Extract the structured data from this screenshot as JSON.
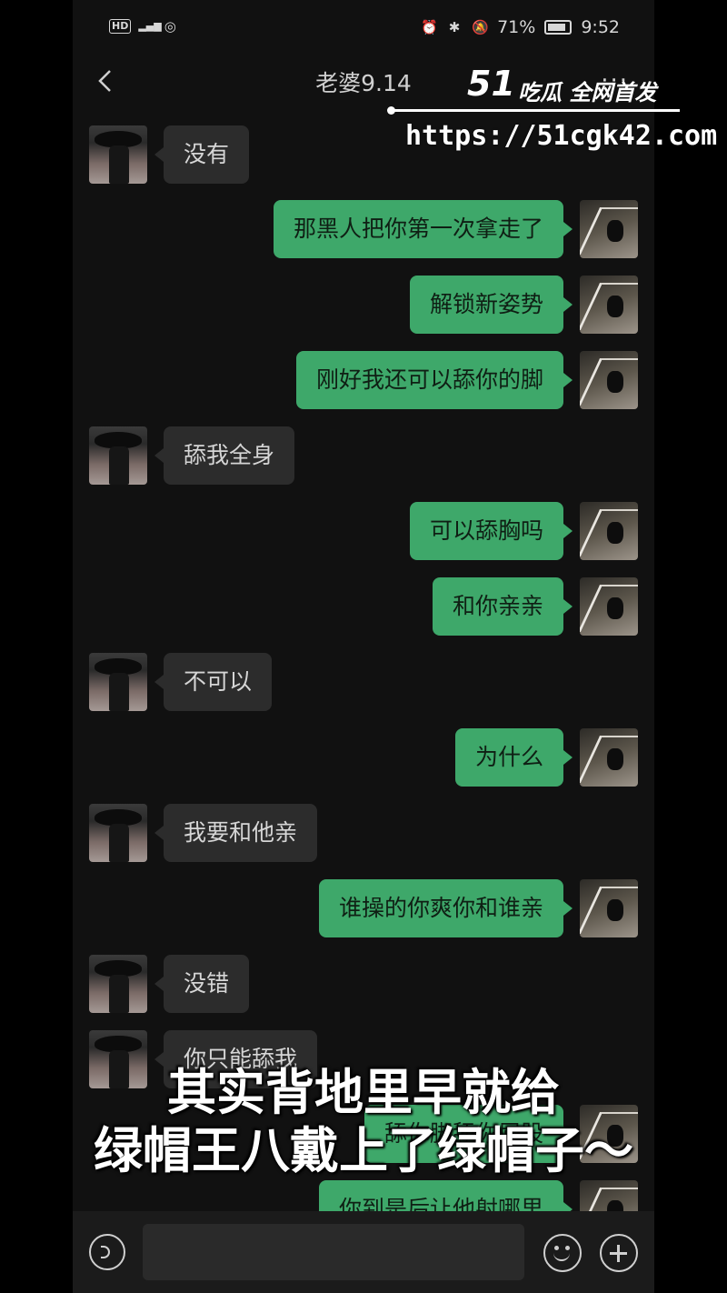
{
  "status_bar": {
    "network": "HD",
    "signal": "4G",
    "battery_percent": "71%",
    "time": "9:52"
  },
  "header": {
    "title": "老婆9.14"
  },
  "messages": [
    {
      "from": "her",
      "text": "没有"
    },
    {
      "from": "me",
      "text": "那黑人把你第一次拿走了"
    },
    {
      "from": "me",
      "text": "解锁新姿势"
    },
    {
      "from": "me",
      "text": "刚好我还可以舔你的脚"
    },
    {
      "from": "her",
      "text": "舔我全身"
    },
    {
      "from": "me",
      "text": "可以舔胸吗"
    },
    {
      "from": "me",
      "text": "和你亲亲"
    },
    {
      "from": "her",
      "text": "不可以"
    },
    {
      "from": "me",
      "text": "为什么"
    },
    {
      "from": "her",
      "text": "我要和他亲"
    },
    {
      "from": "me",
      "text": "谁操的你爽你和谁亲"
    },
    {
      "from": "her",
      "text": "没错"
    },
    {
      "from": "her",
      "text": "你只能舔我"
    },
    {
      "from": "me",
      "text": "舔你脚舔你屁股"
    },
    {
      "from": "me",
      "text": "你到是后让他射哪里"
    }
  ],
  "input_bar": {
    "placeholder": ""
  },
  "watermark": {
    "logo": "51",
    "tagline": "吃瓜 全网首发",
    "url": "https://51cgk42.com"
  },
  "subtitle": {
    "line1": "其实背地里早就给",
    "line2": "绿帽王八戴上了绿帽子～"
  }
}
